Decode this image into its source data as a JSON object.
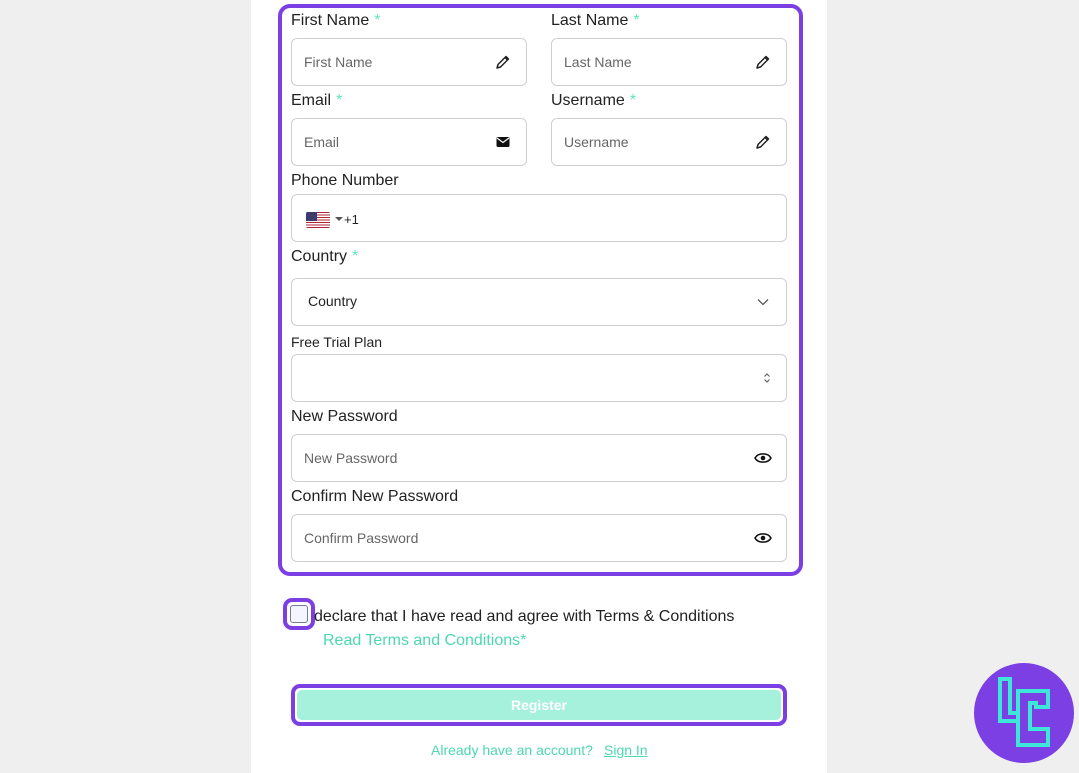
{
  "form": {
    "first_name": {
      "label": "First Name",
      "required": "*",
      "placeholder": "First Name"
    },
    "last_name": {
      "label": "Last Name",
      "required": "*",
      "placeholder": "Last Name"
    },
    "email": {
      "label": "Email",
      "required": "*",
      "placeholder": "Email"
    },
    "username": {
      "label": "Username",
      "required": "*",
      "placeholder": "Username"
    },
    "phone": {
      "label": "Phone Number",
      "dial_code": "+1",
      "flag": "us-flag-icon"
    },
    "country": {
      "label": "Country",
      "required": "*",
      "value": "Country"
    },
    "free_trial_plan": {
      "label": "Free Trial Plan",
      "value": ""
    },
    "new_password": {
      "label": "New Password",
      "placeholder": "New Password"
    },
    "confirm_password": {
      "label": "Confirm New Password",
      "placeholder": "Confirm Password"
    }
  },
  "terms": {
    "declaration": "declare that I have read and agree with Terms & Conditions",
    "link": "Read Terms and Conditions*"
  },
  "register_label": "Register",
  "footer": {
    "already": "Already have an account?",
    "signin": "Sign In"
  },
  "colors": {
    "highlight": "#7b3fe4",
    "accent": "#4dd8b0",
    "register_bg": "#a6f1dc"
  }
}
